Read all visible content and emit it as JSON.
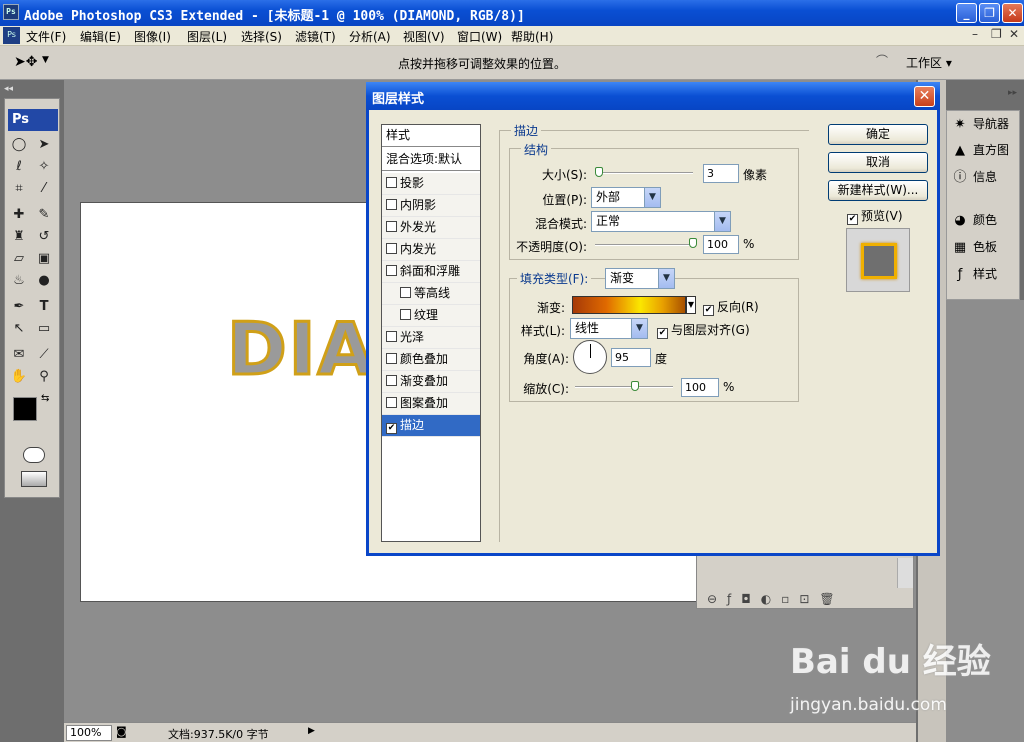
{
  "window": {
    "title": "Adobe Photoshop CS3 Extended - [未标题-1 @ 100% (DIAMOND, RGB/8)]",
    "ps_badge": "Ps"
  },
  "menubar": {
    "items": [
      "文件(F)",
      "编辑(E)",
      "图像(I)",
      "图层(L)",
      "选择(S)",
      "滤镜(T)",
      "分析(A)",
      "视图(V)",
      "窗口(W)",
      "帮助(H)"
    ]
  },
  "options_bar": {
    "hint": "点按并拖移可调整效果的位置。",
    "workspace": "工作区 ▾"
  },
  "toolbox": {
    "logo": "Ps"
  },
  "canvas": {
    "text": "DIAM"
  },
  "status": {
    "zoom": "100%",
    "doc": "文档:937.5K/0 字节"
  },
  "right_panel": {
    "items": [
      {
        "label": "导航器",
        "icon": "navigator-icon"
      },
      {
        "label": "直方图",
        "icon": "histogram-icon"
      },
      {
        "label": "信息",
        "icon": "info-icon"
      },
      {
        "label": "颜色",
        "icon": "color-icon"
      },
      {
        "label": "色板",
        "icon": "swatches-icon"
      },
      {
        "label": "样式",
        "icon": "styles-icon"
      }
    ]
  },
  "dialog": {
    "title": "图层样式",
    "style_list": {
      "header": "样式",
      "blend": "混合选项:默认",
      "items": [
        {
          "label": "投影",
          "checked": false,
          "indent": false
        },
        {
          "label": "内阴影",
          "checked": false,
          "indent": false
        },
        {
          "label": "外发光",
          "checked": false,
          "indent": false
        },
        {
          "label": "内发光",
          "checked": false,
          "indent": false
        },
        {
          "label": "斜面和浮雕",
          "checked": false,
          "indent": false
        },
        {
          "label": "等高线",
          "checked": false,
          "indent": true
        },
        {
          "label": "纹理",
          "checked": false,
          "indent": true
        },
        {
          "label": "光泽",
          "checked": false,
          "indent": false
        },
        {
          "label": "颜色叠加",
          "checked": false,
          "indent": false
        },
        {
          "label": "渐变叠加",
          "checked": false,
          "indent": false
        },
        {
          "label": "图案叠加",
          "checked": false,
          "indent": false
        },
        {
          "label": "描边",
          "checked": true,
          "indent": false,
          "selected": true
        }
      ]
    },
    "stroke": {
      "group": "描边",
      "structure": "结构",
      "size_label": "大小(S):",
      "size_value": "3",
      "size_unit": "像素",
      "position_label": "位置(P):",
      "position_value": "外部",
      "blend_label": "混合模式:",
      "blend_value": "正常",
      "opacity_label": "不透明度(O):",
      "opacity_value": "100",
      "opacity_unit": "%",
      "fill_type_label": "填充类型(F):",
      "fill_type_value": "渐变",
      "gradient_label": "渐变:",
      "reverse_label": "反向(R)",
      "reverse_checked": true,
      "style_label": "样式(L):",
      "style_value": "线性",
      "align_label": "与图层对齐(G)",
      "align_checked": true,
      "angle_label": "角度(A):",
      "angle_value": "95",
      "angle_unit": "度",
      "scale_label": "缩放(C):",
      "scale_value": "100",
      "scale_unit": "%"
    },
    "buttons": {
      "ok": "确定",
      "cancel": "取消",
      "new_style": "新建样式(W)..."
    },
    "preview_label": "预览(V)",
    "preview_checked": true
  },
  "watermark": {
    "line1": "Bai du 经验",
    "line2": "jingyan.baidu.com"
  }
}
